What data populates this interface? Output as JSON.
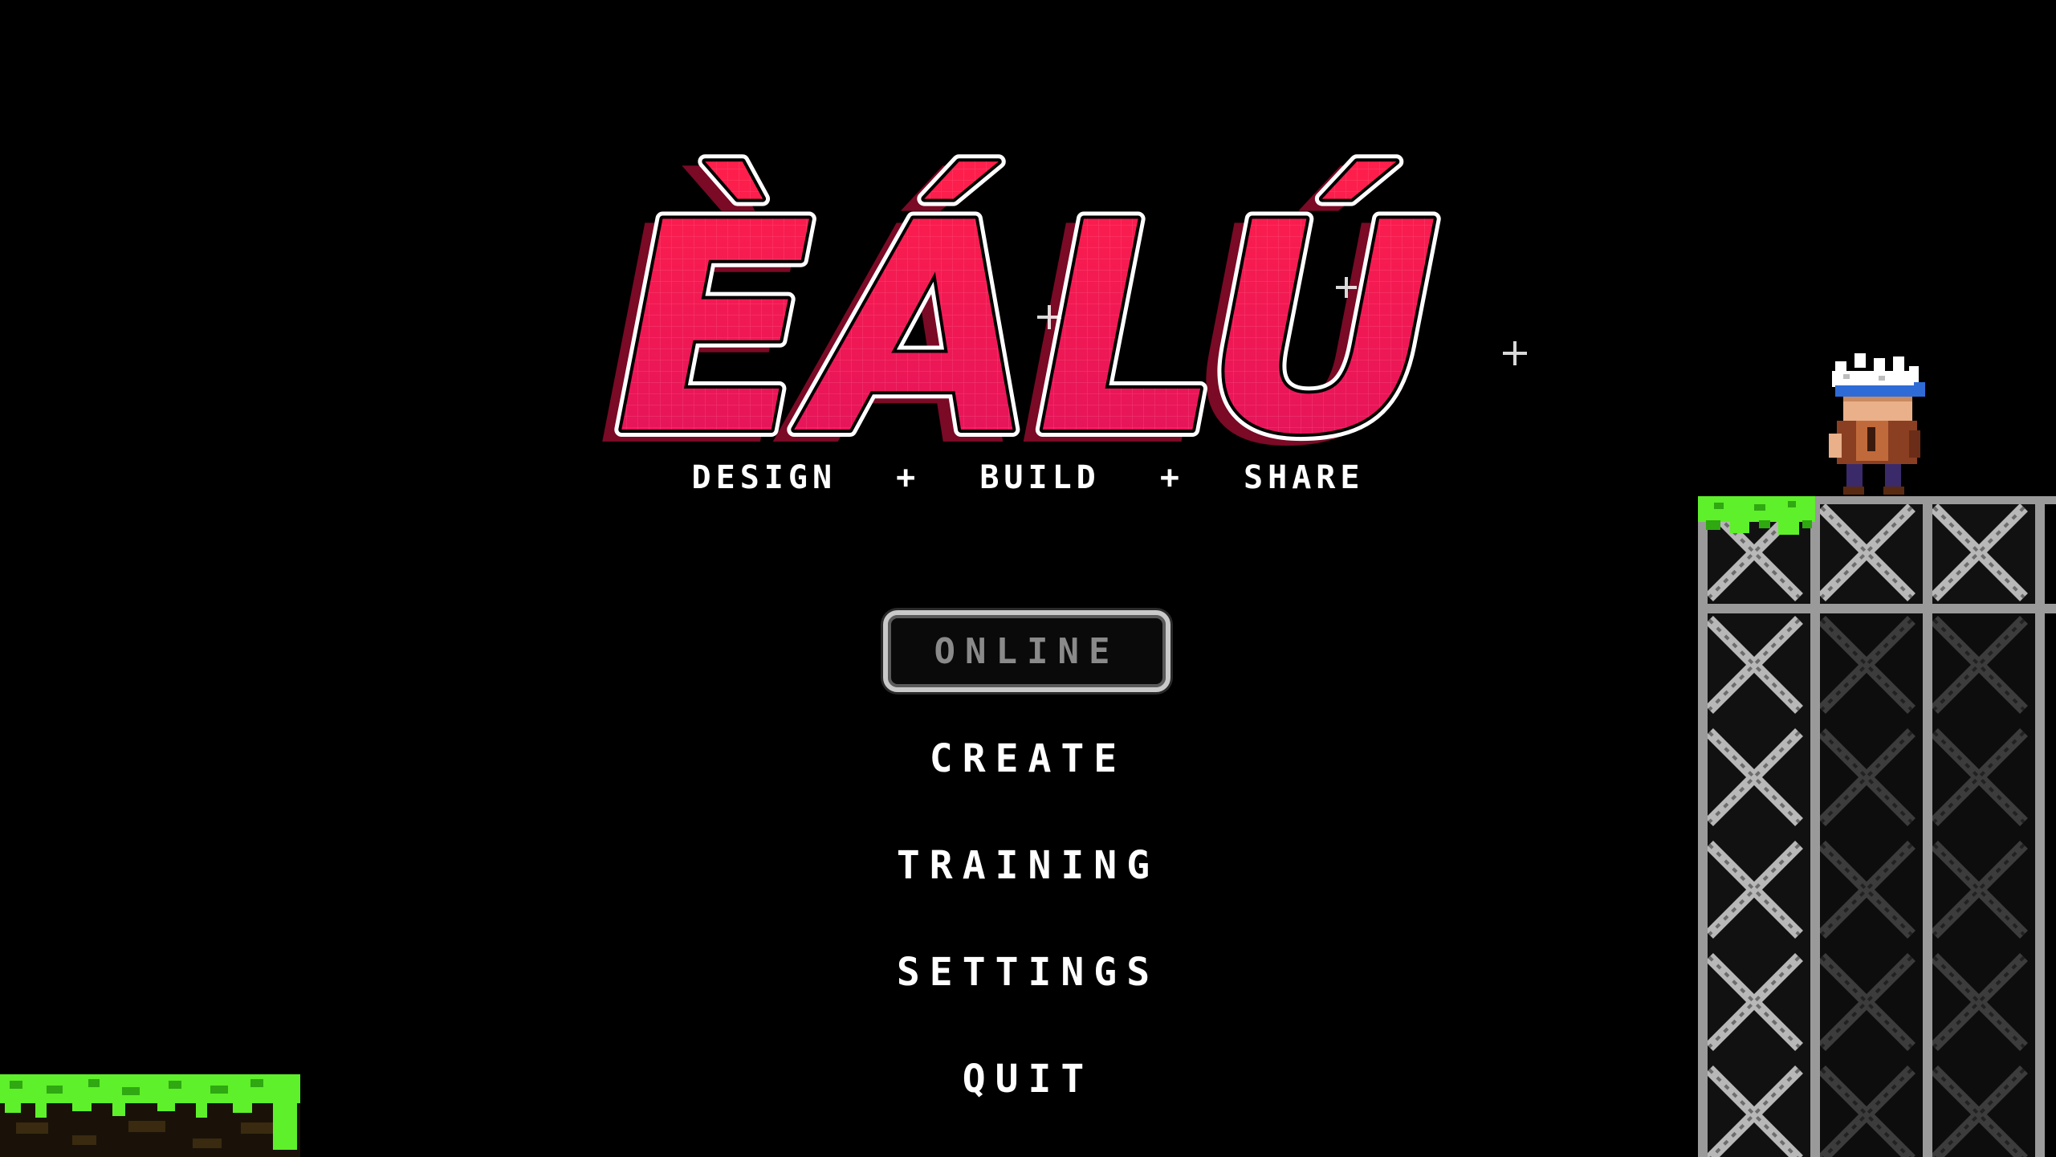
{
  "game": {
    "logo_text": "ÈÁLÚ",
    "tagline": {
      "part1": "DESIGN",
      "separator": "+",
      "part2": "BUILD",
      "part3": "SHARE"
    }
  },
  "menu": {
    "online": "ONLINE",
    "create": "CREATE",
    "training": "TRAINING",
    "settings": "SETTINGS",
    "quit": "QUIT",
    "selected": "ONLINE"
  },
  "colors": {
    "background": "#000000",
    "logo_fill_top": "#ff1f4b",
    "logo_fill_bottom": "#e0125e",
    "logo_shadow": "#8a0c2a",
    "logo_outline": "#ffffff",
    "menu_text": "#ffffff",
    "menu_selected_text": "#8a8a8a",
    "grass": "#5ef02a",
    "scaffold": "#9a9a9a"
  },
  "icons": {
    "player": "player-character-sprite",
    "tower": "metal-scaffold-tower",
    "ground": "grass-dirt-platform"
  }
}
